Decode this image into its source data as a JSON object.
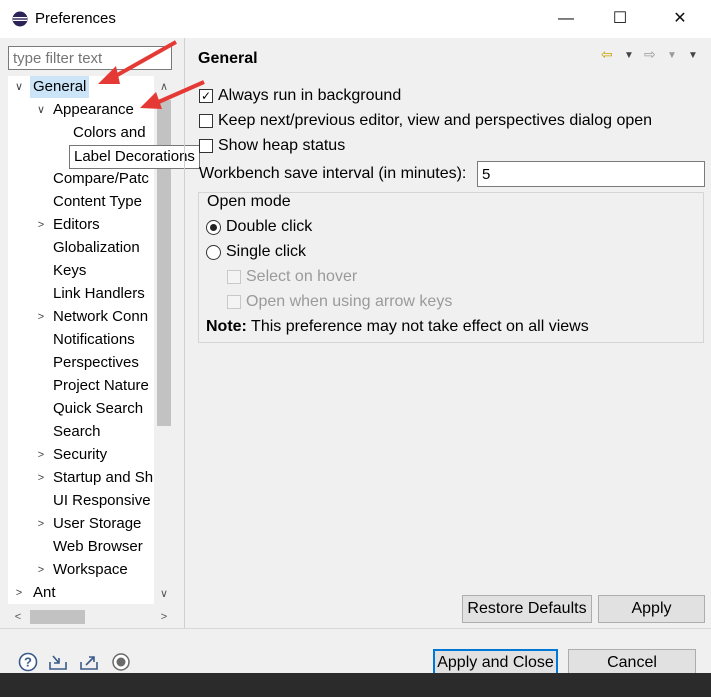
{
  "window": {
    "title": "Preferences",
    "controls": {
      "minimize": "—",
      "maximize": "☐",
      "close": "✕"
    }
  },
  "filter": {
    "placeholder": "type filter text"
  },
  "tree": {
    "items": [
      {
        "label": "General",
        "expander": "∨",
        "level": 0,
        "selected": true
      },
      {
        "label": "Appearance",
        "expander": "∨",
        "level": 1
      },
      {
        "label": "Colors and",
        "expander": "",
        "level": 2
      },
      {
        "label": "",
        "expander": "",
        "level": 2
      },
      {
        "label": "Compare/Patc",
        "expander": "",
        "level": 1
      },
      {
        "label": "Content Type",
        "expander": "",
        "level": 1
      },
      {
        "label": "Editors",
        "expander": ">",
        "level": 1
      },
      {
        "label": "Globalization",
        "expander": "",
        "level": 1
      },
      {
        "label": "Keys",
        "expander": "",
        "level": 1
      },
      {
        "label": "Link Handlers",
        "expander": "",
        "level": 1
      },
      {
        "label": "Network Conn",
        "expander": ">",
        "level": 1
      },
      {
        "label": "Notifications",
        "expander": "",
        "level": 1
      },
      {
        "label": "Perspectives",
        "expander": "",
        "level": 1
      },
      {
        "label": "Project Nature",
        "expander": "",
        "level": 1
      },
      {
        "label": "Quick Search",
        "expander": "",
        "level": 1
      },
      {
        "label": "Search",
        "expander": "",
        "level": 1
      },
      {
        "label": "Security",
        "expander": ">",
        "level": 1
      },
      {
        "label": "Startup and Sh",
        "expander": ">",
        "level": 1
      },
      {
        "label": "UI Responsive",
        "expander": "",
        "level": 1
      },
      {
        "label": "User Storage",
        "expander": ">",
        "level": 1
      },
      {
        "label": "Web Browser",
        "expander": "",
        "level": 1
      },
      {
        "label": "Workspace",
        "expander": ">",
        "level": 1
      },
      {
        "label": "Ant",
        "expander": ">",
        "level": 0
      }
    ],
    "tooltip": "Label Decorations"
  },
  "main": {
    "title": "General",
    "nav": {
      "back": "⇦",
      "forward": "⇨",
      "menu": "▼"
    },
    "always_run_label": "Always run in background",
    "always_run_checked": true,
    "keep_dialog_label": "Keep next/previous editor, view and perspectives dialog open",
    "keep_dialog_checked": false,
    "heap_label": "Show heap status",
    "heap_checked": false,
    "save_interval_label": "Workbench save interval (in minutes):",
    "save_interval_value": "5",
    "open_mode": {
      "title": "Open mode",
      "double_click": "Double click",
      "single_click": "Single click",
      "selected": "double_click",
      "select_on_hover": "Select on hover",
      "open_arrow_keys": "Open when using arrow keys",
      "note_bold": "Note:",
      "note_text": " This preference may not take effect on all views"
    },
    "restore_defaults": "Restore Defaults",
    "apply": "Apply"
  },
  "footer": {
    "icons": [
      "help-icon",
      "import-icon",
      "export-icon",
      "record-icon"
    ],
    "apply_close": "Apply and Close",
    "cancel": "Cancel"
  },
  "colors": {
    "accent": "#0078d7",
    "selection": "#cce4f7",
    "annotation": "#e53935"
  }
}
